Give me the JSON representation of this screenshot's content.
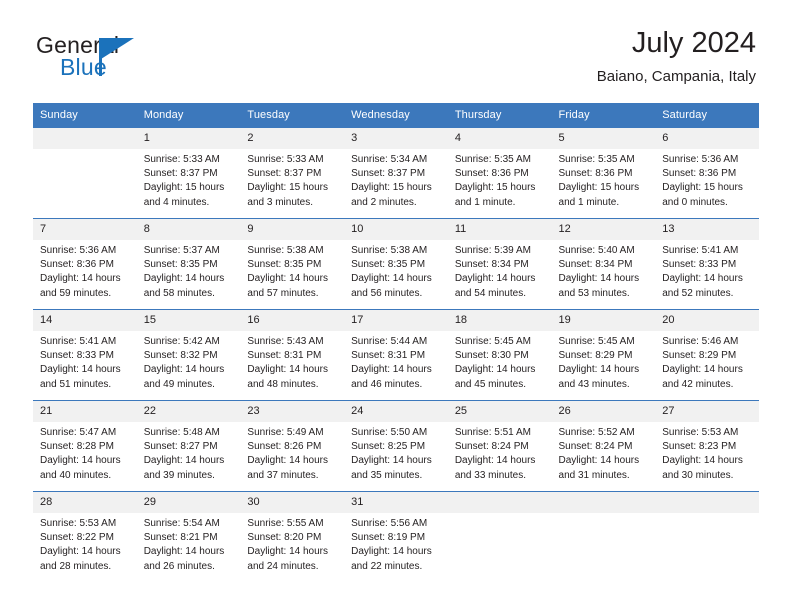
{
  "brand": {
    "name_part1": "General",
    "name_part2": "Blue",
    "accent_color": "#1b72bb",
    "flag_icon": "triangle-flag-icon"
  },
  "header": {
    "title": "July 2024",
    "subtitle": "Baiano, Campania, Italy",
    "header_bg": "#3c78bc",
    "daynum_bg": "#f1f1f1"
  },
  "weekday_headers": [
    "Sunday",
    "Monday",
    "Tuesday",
    "Wednesday",
    "Thursday",
    "Friday",
    "Saturday"
  ],
  "weeks": [
    {
      "days": [
        {
          "num": "",
          "sunrise": "",
          "sunset": "",
          "daylight1": "",
          "daylight2": ""
        },
        {
          "num": "1",
          "sunrise": "Sunrise: 5:33 AM",
          "sunset": "Sunset: 8:37 PM",
          "daylight1": "Daylight: 15 hours",
          "daylight2": "and 4 minutes."
        },
        {
          "num": "2",
          "sunrise": "Sunrise: 5:33 AM",
          "sunset": "Sunset: 8:37 PM",
          "daylight1": "Daylight: 15 hours",
          "daylight2": "and 3 minutes."
        },
        {
          "num": "3",
          "sunrise": "Sunrise: 5:34 AM",
          "sunset": "Sunset: 8:37 PM",
          "daylight1": "Daylight: 15 hours",
          "daylight2": "and 2 minutes."
        },
        {
          "num": "4",
          "sunrise": "Sunrise: 5:35 AM",
          "sunset": "Sunset: 8:36 PM",
          "daylight1": "Daylight: 15 hours",
          "daylight2": "and 1 minute."
        },
        {
          "num": "5",
          "sunrise": "Sunrise: 5:35 AM",
          "sunset": "Sunset: 8:36 PM",
          "daylight1": "Daylight: 15 hours",
          "daylight2": "and 1 minute."
        },
        {
          "num": "6",
          "sunrise": "Sunrise: 5:36 AM",
          "sunset": "Sunset: 8:36 PM",
          "daylight1": "Daylight: 15 hours",
          "daylight2": "and 0 minutes."
        }
      ]
    },
    {
      "days": [
        {
          "num": "7",
          "sunrise": "Sunrise: 5:36 AM",
          "sunset": "Sunset: 8:36 PM",
          "daylight1": "Daylight: 14 hours",
          "daylight2": "and 59 minutes."
        },
        {
          "num": "8",
          "sunrise": "Sunrise: 5:37 AM",
          "sunset": "Sunset: 8:35 PM",
          "daylight1": "Daylight: 14 hours",
          "daylight2": "and 58 minutes."
        },
        {
          "num": "9",
          "sunrise": "Sunrise: 5:38 AM",
          "sunset": "Sunset: 8:35 PM",
          "daylight1": "Daylight: 14 hours",
          "daylight2": "and 57 minutes."
        },
        {
          "num": "10",
          "sunrise": "Sunrise: 5:38 AM",
          "sunset": "Sunset: 8:35 PM",
          "daylight1": "Daylight: 14 hours",
          "daylight2": "and 56 minutes."
        },
        {
          "num": "11",
          "sunrise": "Sunrise: 5:39 AM",
          "sunset": "Sunset: 8:34 PM",
          "daylight1": "Daylight: 14 hours",
          "daylight2": "and 54 minutes."
        },
        {
          "num": "12",
          "sunrise": "Sunrise: 5:40 AM",
          "sunset": "Sunset: 8:34 PM",
          "daylight1": "Daylight: 14 hours",
          "daylight2": "and 53 minutes."
        },
        {
          "num": "13",
          "sunrise": "Sunrise: 5:41 AM",
          "sunset": "Sunset: 8:33 PM",
          "daylight1": "Daylight: 14 hours",
          "daylight2": "and 52 minutes."
        }
      ]
    },
    {
      "days": [
        {
          "num": "14",
          "sunrise": "Sunrise: 5:41 AM",
          "sunset": "Sunset: 8:33 PM",
          "daylight1": "Daylight: 14 hours",
          "daylight2": "and 51 minutes."
        },
        {
          "num": "15",
          "sunrise": "Sunrise: 5:42 AM",
          "sunset": "Sunset: 8:32 PM",
          "daylight1": "Daylight: 14 hours",
          "daylight2": "and 49 minutes."
        },
        {
          "num": "16",
          "sunrise": "Sunrise: 5:43 AM",
          "sunset": "Sunset: 8:31 PM",
          "daylight1": "Daylight: 14 hours",
          "daylight2": "and 48 minutes."
        },
        {
          "num": "17",
          "sunrise": "Sunrise: 5:44 AM",
          "sunset": "Sunset: 8:31 PM",
          "daylight1": "Daylight: 14 hours",
          "daylight2": "and 46 minutes."
        },
        {
          "num": "18",
          "sunrise": "Sunrise: 5:45 AM",
          "sunset": "Sunset: 8:30 PM",
          "daylight1": "Daylight: 14 hours",
          "daylight2": "and 45 minutes."
        },
        {
          "num": "19",
          "sunrise": "Sunrise: 5:45 AM",
          "sunset": "Sunset: 8:29 PM",
          "daylight1": "Daylight: 14 hours",
          "daylight2": "and 43 minutes."
        },
        {
          "num": "20",
          "sunrise": "Sunrise: 5:46 AM",
          "sunset": "Sunset: 8:29 PM",
          "daylight1": "Daylight: 14 hours",
          "daylight2": "and 42 minutes."
        }
      ]
    },
    {
      "days": [
        {
          "num": "21",
          "sunrise": "Sunrise: 5:47 AM",
          "sunset": "Sunset: 8:28 PM",
          "daylight1": "Daylight: 14 hours",
          "daylight2": "and 40 minutes."
        },
        {
          "num": "22",
          "sunrise": "Sunrise: 5:48 AM",
          "sunset": "Sunset: 8:27 PM",
          "daylight1": "Daylight: 14 hours",
          "daylight2": "and 39 minutes."
        },
        {
          "num": "23",
          "sunrise": "Sunrise: 5:49 AM",
          "sunset": "Sunset: 8:26 PM",
          "daylight1": "Daylight: 14 hours",
          "daylight2": "and 37 minutes."
        },
        {
          "num": "24",
          "sunrise": "Sunrise: 5:50 AM",
          "sunset": "Sunset: 8:25 PM",
          "daylight1": "Daylight: 14 hours",
          "daylight2": "and 35 minutes."
        },
        {
          "num": "25",
          "sunrise": "Sunrise: 5:51 AM",
          "sunset": "Sunset: 8:24 PM",
          "daylight1": "Daylight: 14 hours",
          "daylight2": "and 33 minutes."
        },
        {
          "num": "26",
          "sunrise": "Sunrise: 5:52 AM",
          "sunset": "Sunset: 8:24 PM",
          "daylight1": "Daylight: 14 hours",
          "daylight2": "and 31 minutes."
        },
        {
          "num": "27",
          "sunrise": "Sunrise: 5:53 AM",
          "sunset": "Sunset: 8:23 PM",
          "daylight1": "Daylight: 14 hours",
          "daylight2": "and 30 minutes."
        }
      ]
    },
    {
      "days": [
        {
          "num": "28",
          "sunrise": "Sunrise: 5:53 AM",
          "sunset": "Sunset: 8:22 PM",
          "daylight1": "Daylight: 14 hours",
          "daylight2": "and 28 minutes."
        },
        {
          "num": "29",
          "sunrise": "Sunrise: 5:54 AM",
          "sunset": "Sunset: 8:21 PM",
          "daylight1": "Daylight: 14 hours",
          "daylight2": "and 26 minutes."
        },
        {
          "num": "30",
          "sunrise": "Sunrise: 5:55 AM",
          "sunset": "Sunset: 8:20 PM",
          "daylight1": "Daylight: 14 hours",
          "daylight2": "and 24 minutes."
        },
        {
          "num": "31",
          "sunrise": "Sunrise: 5:56 AM",
          "sunset": "Sunset: 8:19 PM",
          "daylight1": "Daylight: 14 hours",
          "daylight2": "and 22 minutes."
        },
        {
          "num": "",
          "sunrise": "",
          "sunset": "",
          "daylight1": "",
          "daylight2": ""
        },
        {
          "num": "",
          "sunrise": "",
          "sunset": "",
          "daylight1": "",
          "daylight2": ""
        },
        {
          "num": "",
          "sunrise": "",
          "sunset": "",
          "daylight1": "",
          "daylight2": ""
        }
      ]
    }
  ]
}
